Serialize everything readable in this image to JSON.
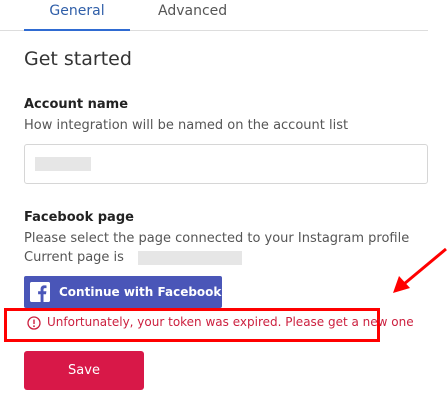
{
  "tabs": {
    "general": "General",
    "advanced": "Advanced"
  },
  "title": "Get started",
  "account_name": {
    "label": "Account name",
    "help": "How integration will be named on the account list",
    "value": ""
  },
  "facebook_page": {
    "label": "Facebook page",
    "help": "Please select the page connected to your Instagram profile",
    "current_prefix": "Current page is ",
    "button_label": "Continue with Facebook"
  },
  "error": {
    "message": "Unfortunately, your token was expired. Please get a new one"
  },
  "save_label": "Save",
  "colors": {
    "tab_active": "#2f6bd2",
    "facebook_button": "#4a56b8",
    "error_text": "#cc1f3e",
    "highlight": "#ff0000",
    "save_button": "#d81848"
  },
  "icons": {
    "facebook": "facebook-icon",
    "error": "error-circle-icon",
    "annotation": "arrow-icon"
  }
}
